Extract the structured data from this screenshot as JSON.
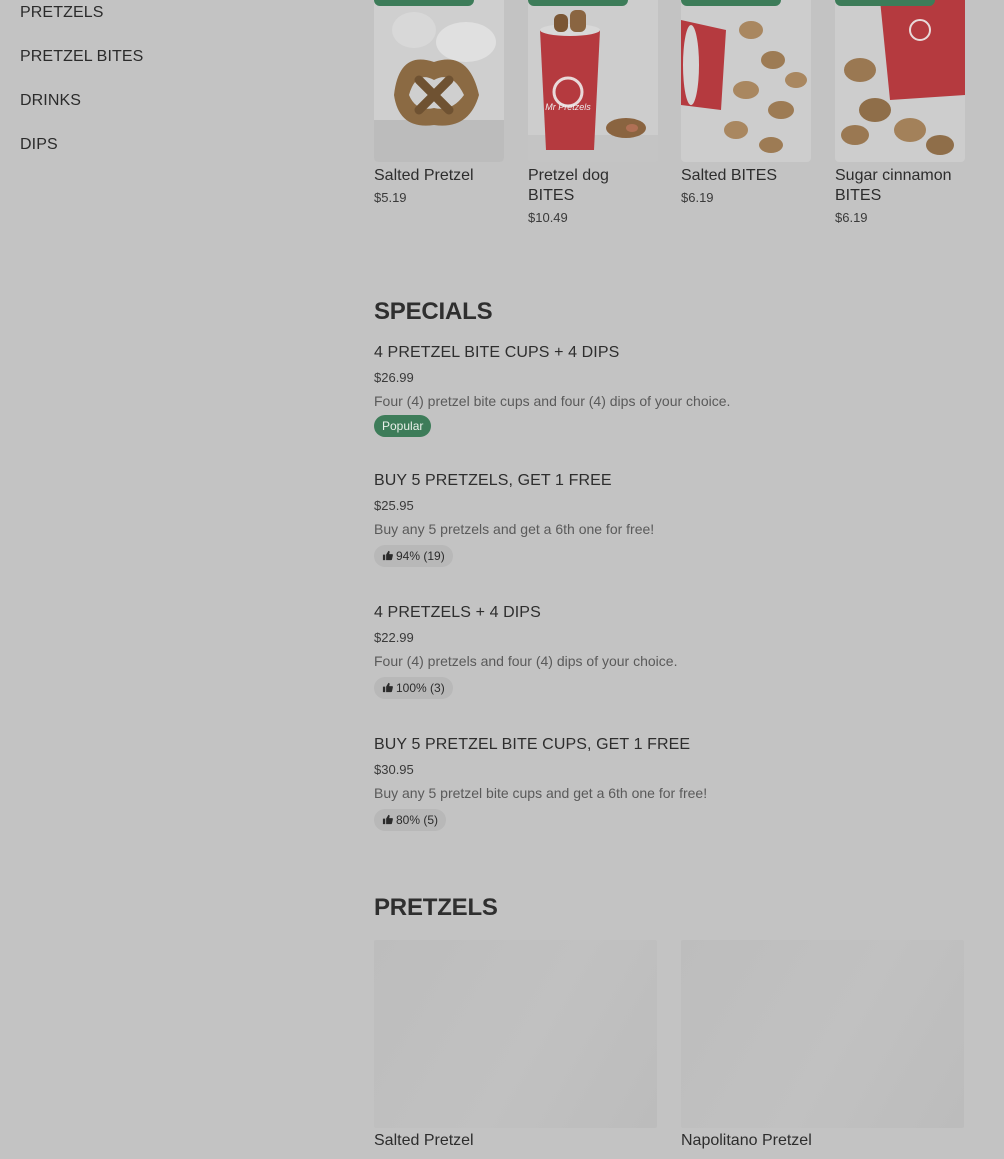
{
  "sidebar": {
    "items": [
      {
        "label": "PRETZELS"
      },
      {
        "label": "PRETZEL BITES"
      },
      {
        "label": "DRINKS"
      },
      {
        "label": "DIPS"
      }
    ]
  },
  "carousel": {
    "items": [
      {
        "name": "Salted Pretzel",
        "price": "$5.19"
      },
      {
        "name": "Pretzel dog BITES",
        "price": "$10.49"
      },
      {
        "name": "Salted BITES",
        "price": "$6.19"
      },
      {
        "name": "Sugar cinnamon BITES",
        "price": "$6.19"
      }
    ],
    "cup_brand": "Mr Pretzels"
  },
  "specials": {
    "title": "SPECIALS",
    "items": [
      {
        "title": "4 PRETZEL BITE CUPS + 4 DIPS",
        "price": "$26.99",
        "description": "Four (4) pretzel bite cups and four (4) dips of your choice.",
        "badge": "Popular"
      },
      {
        "title": "BUY 5 PRETZELS, GET 1 FREE",
        "price": "$25.95",
        "description": "Buy any 5 pretzels and get a 6th one for free!",
        "rating": "94% (19)"
      },
      {
        "title": "4 PRETZELS + 4 DIPS",
        "price": "$22.99",
        "description": "Four (4) pretzels and four (4) dips of your choice.",
        "rating": "100% (3)"
      },
      {
        "title": "BUY 5 PRETZEL BITE CUPS, GET 1 FREE",
        "price": "$30.95",
        "description": "Buy any 5 pretzel bite cups and get a 6th one for free!",
        "rating": "80% (5)"
      }
    ]
  },
  "pretzels": {
    "title": "PRETZELS",
    "items": [
      {
        "name": "Salted Pretzel"
      },
      {
        "name": "Napolitano Pretzel"
      }
    ]
  },
  "icons": {
    "rating": "thumbs-up-icon"
  },
  "colors": {
    "accent": "#3d7c59",
    "overlay_background": "#c3c3c3"
  }
}
